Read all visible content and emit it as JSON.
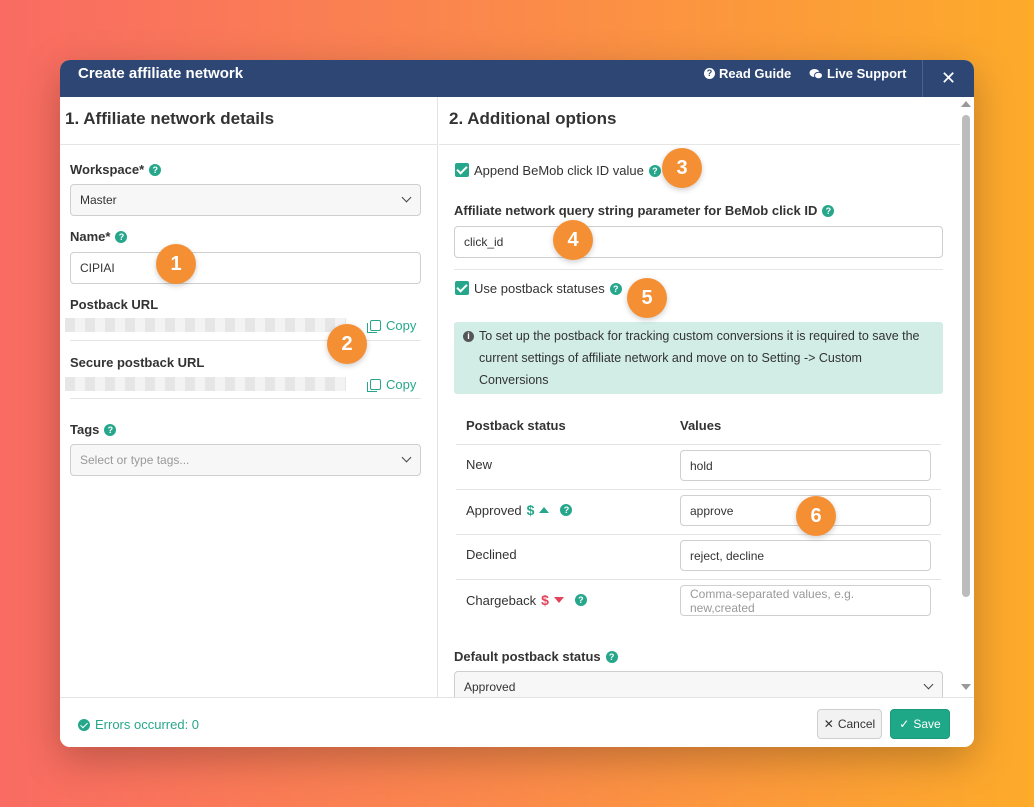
{
  "header": {
    "title": "Create affiliate network",
    "read_guide": "Read Guide",
    "live_support": "Live Support",
    "close": "✕"
  },
  "left": {
    "section_title": "1. Affiliate network details",
    "workspace_label": "Workspace*",
    "workspace_value": "Master",
    "name_label": "Name*",
    "name_value": "CIPIAI",
    "postback_label": "Postback URL",
    "copy_label": "Copy",
    "secure_postback_label": "Secure postback URL",
    "tags_label": "Tags",
    "tags_placeholder": "Select or type tags..."
  },
  "right": {
    "section_title": "2. Additional options",
    "append_label": "Append BeMob click ID value",
    "query_param_label": "Affiliate network query string parameter for BeMob click ID",
    "query_param_value": "click_id",
    "use_postback_label": "Use postback statuses",
    "info_text": "To set up the postback for tracking custom conversions it is required to save the current settings of affiliate network and move on to Setting -> Custom Conversions",
    "table_headers": [
      "Postback status",
      "Values"
    ],
    "rows": [
      {
        "status": "New",
        "value": "hold"
      },
      {
        "status": "Approved",
        "value": "approve"
      },
      {
        "status": "Declined",
        "value": "reject, decline"
      },
      {
        "status": "Chargeback",
        "value": ""
      }
    ],
    "chargeback_placeholder": "Comma-separated values, e.g. new,created",
    "dollar": "$",
    "default_status_label": "Default postback status",
    "default_status_value": "Approved"
  },
  "footer": {
    "status_text": "Errors occurred: 0",
    "cancel_label": "Cancel",
    "save_label": "Save"
  },
  "badges": [
    "1",
    "2",
    "3",
    "4",
    "5",
    "6"
  ],
  "colors": {
    "accent": "#26a78b",
    "header_bg": "#2d4673",
    "badge": "#f58f33",
    "danger": "#e0435a"
  }
}
